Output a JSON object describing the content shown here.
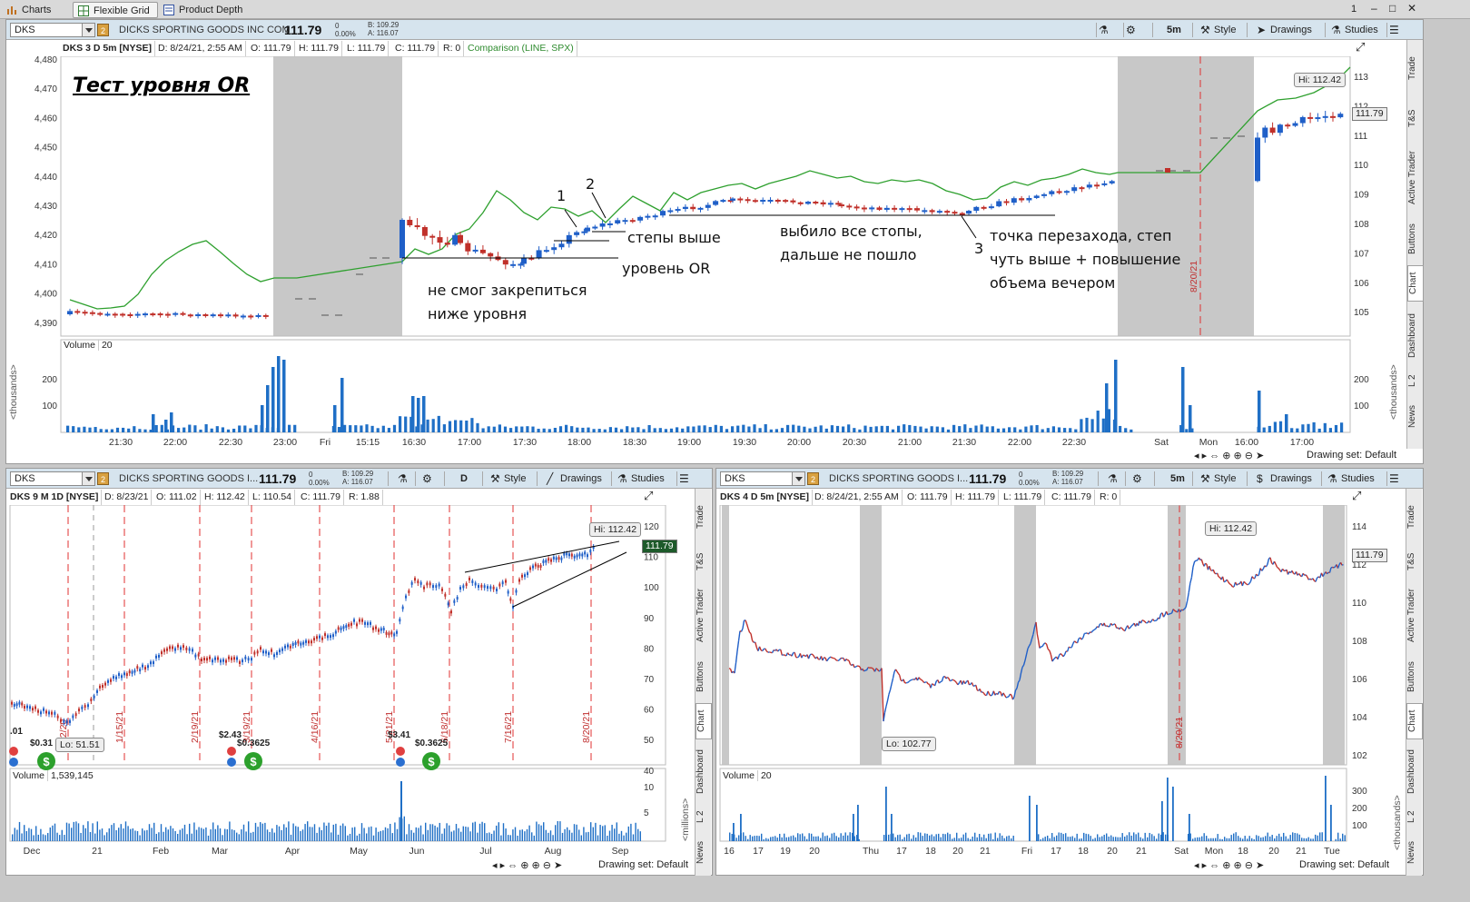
{
  "topbar": {
    "tabs": [
      {
        "label": "Charts",
        "icon": "bar-chart-icon",
        "active": false
      },
      {
        "label": "Flexible Grid",
        "icon": "grid-icon",
        "active": true
      },
      {
        "label": "Product Depth",
        "icon": "depth-icon",
        "active": false
      }
    ],
    "page_num": "1",
    "window_controls": [
      "–",
      "□",
      "✕"
    ]
  },
  "main": {
    "symbol": "DKS",
    "link": "2",
    "name": "DICKS SPORTING GOODS INC COM",
    "price": "111.79",
    "chg1": "0",
    "chg2": "0.00%",
    "bid": "B: 109.29",
    "ask": "A: 116.07",
    "timeframe": "5m",
    "style": "Style",
    "drawings": "Drawings",
    "studies": "Studies",
    "info": {
      "desc": "DKS 3 D 5m [NYSE]",
      "date": "D: 8/24/21, 2:55 AM",
      "open": "O: 111.79",
      "high": "H: 111.79",
      "low": "L: 111.79",
      "close": "C: 111.79",
      "range": "R: 0",
      "comparison": "Comparison (LINE, SPX)"
    },
    "headline": "Тест уровня OR",
    "left_axis": [
      "4,480",
      "4,470",
      "4,460",
      "4,450",
      "4,440",
      "4,430",
      "4,420",
      "4,410",
      "4,400",
      "4,390"
    ],
    "right_axis": [
      "113",
      "112",
      "111",
      "110",
      "109",
      "108",
      "107",
      "106",
      "105"
    ],
    "hi_label": "Hi: 112.42",
    "price_tag": "111.79",
    "date_marker": "8/20/21",
    "annotations": {
      "n1": "1",
      "n2": "2",
      "n3": "3",
      "steps": "степы выше",
      "or_level": "уровень OR",
      "failed": "не смог закрепиться\nниже уровня",
      "stops": "выбило все стопы,\nдальше не пошло",
      "reentry": "точка перезахода, степ\nчуть выше + повышение\nобъема вечером"
    },
    "volume_label": "Volume",
    "volume_period": "20",
    "volume_axis": [
      "200",
      "100"
    ],
    "volume_unit": "<thousands>",
    "time_axis": [
      "21:30",
      "22:00",
      "22:30",
      "23:00",
      "Fri",
      "15:15",
      "16:30",
      "17:00",
      "17:30",
      "18:00",
      "18:30",
      "19:00",
      "19:30",
      "20:00",
      "20:30",
      "21:00",
      "21:30",
      "22:00",
      "22:30",
      "Sat",
      "Mon",
      "16:00",
      "17:00"
    ],
    "drawing_set": "Drawing set: Default",
    "side_tabs": [
      "Trade",
      "T&S",
      "Active Trader",
      "Buttons",
      "Chart",
      "Dashboard",
      "L 2",
      "News"
    ]
  },
  "left_panel": {
    "symbol": "DKS",
    "link": "2",
    "name": "DICKS SPORTING GOODS I...",
    "price": "111.79",
    "chg1": "0",
    "chg2": "0.00%",
    "bid": "B: 109.29",
    "ask": "A: 116.07",
    "timeframe": "D",
    "style": "Style",
    "drawings": "Drawings",
    "studies": "Studies",
    "info": {
      "desc": "DKS 9 M 1D [NYSE]",
      "date": "D: 8/23/21",
      "open": "O: 111.02",
      "high": "H: 112.42",
      "low": "L: 110.54",
      "close": "C: 111.79",
      "range": "R: 1.88"
    },
    "right_axis": [
      "120",
      "110",
      "100",
      "90",
      "80",
      "70",
      "60",
      "50",
      "40"
    ],
    "hi_label": "Hi: 112.42",
    "lo_label": "Lo: 51.51",
    "price_tag": "111.79",
    "date_markers": [
      "1/15/21",
      "2/19/21",
      "3/19/21",
      "4/16/21",
      "5/21/21",
      "6/18/21",
      "7/16/21",
      "8/20/21",
      "12/20"
    ],
    "dividends": [
      "$0.31",
      "$2.43",
      "$0.3625",
      "$3.41",
      "$0.3625"
    ],
    "div_cut": ".01",
    "volume_label": "Volume",
    "volume_value": "1,539,145",
    "volume_axis": [
      "10",
      "5"
    ],
    "volume_unit": "<millions>",
    "time_axis": [
      "Dec",
      "21",
      "Feb",
      "Mar",
      "Apr",
      "May",
      "Jun",
      "Jul",
      "Aug",
      "Sep"
    ],
    "drawing_set": "Drawing set: Default",
    "side_tabs": [
      "Trade",
      "T&S",
      "Active Trader",
      "Buttons",
      "Chart",
      "Dashboard",
      "L 2",
      "News"
    ]
  },
  "right_panel": {
    "symbol": "DKS",
    "link": "2",
    "name": "DICKS SPORTING GOODS I...",
    "price": "111.79",
    "chg1": "0",
    "chg2": "0.00%",
    "bid": "B: 109.29",
    "ask": "A: 116.07",
    "timeframe": "5m",
    "style": "Style",
    "drawings": "Drawings",
    "studies": "Studies",
    "info": {
      "desc": "DKS 4 D 5m [NYSE]",
      "date": "D: 8/24/21, 2:55 AM",
      "open": "O: 111.79",
      "high": "H: 111.79",
      "low": "L: 111.79",
      "close": "C: 111.79",
      "range": "R: 0"
    },
    "right_axis": [
      "114",
      "112",
      "110",
      "108",
      "106",
      "104",
      "102"
    ],
    "hi_label": "Hi: 112.42",
    "lo_label": "Lo: 102.77",
    "price_tag": "111.79",
    "date_marker": "8/20/21",
    "volume_label": "Volume",
    "volume_period": "20",
    "volume_axis": [
      "300",
      "200",
      "100"
    ],
    "volume_unit": "<thousands>",
    "time_axis": [
      "16",
      "17",
      "19",
      "20",
      "Thu",
      "17",
      "18",
      "20",
      "21",
      "Fri",
      "17",
      "18",
      "20",
      "21",
      "Sat",
      "Mon",
      "18",
      "20",
      "21",
      "Tue"
    ],
    "drawing_set": "Drawing set: Default",
    "side_tabs": [
      "Trade",
      "T&S",
      "Active Trader",
      "Buttons",
      "Chart",
      "Dashboard",
      "L 2",
      "News"
    ]
  },
  "colors": {
    "up": "#1f5fc8",
    "down": "#c0302a",
    "compare": "#2ea02e",
    "vol": "#1f6fc6",
    "shade": "#c8c8c8",
    "marker": "#e03030"
  }
}
